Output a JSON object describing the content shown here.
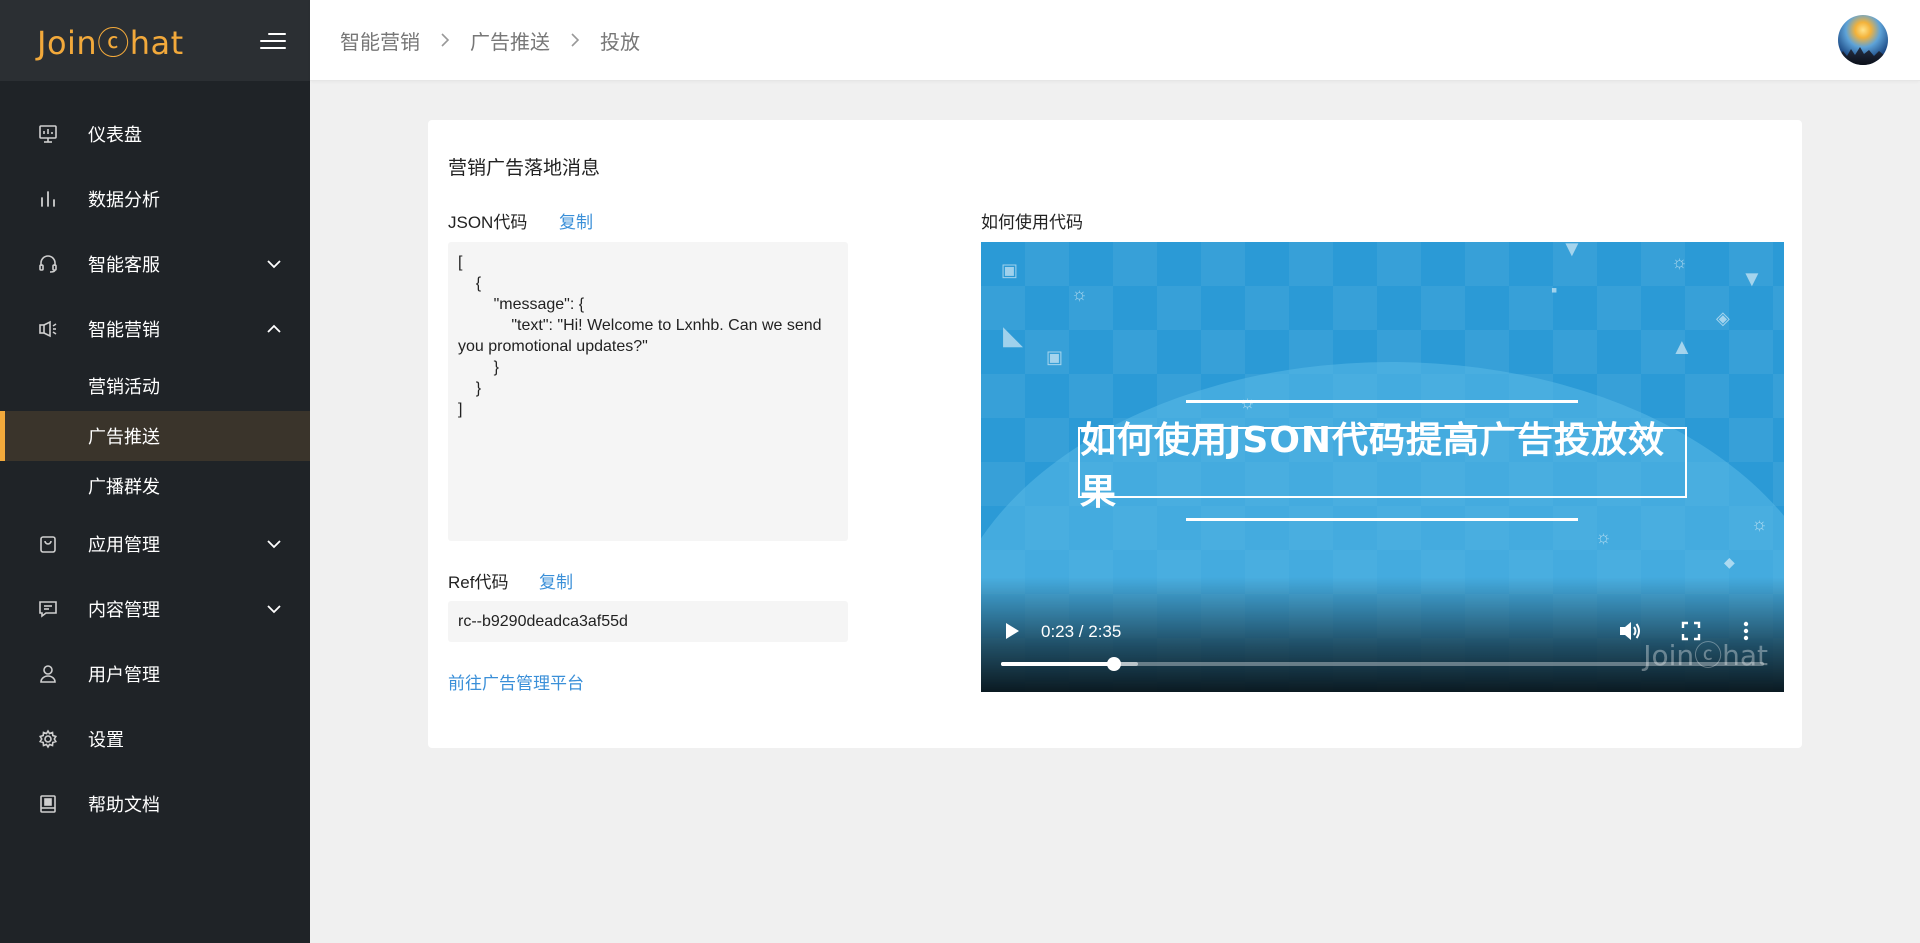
{
  "sidebar": {
    "logo": "Joinⓒhat",
    "items": [
      {
        "label": "仪表盘",
        "icon": "dashboard-icon"
      },
      {
        "label": "数据分析",
        "icon": "bar-chart-icon"
      },
      {
        "label": "智能客服",
        "icon": "headset-icon",
        "expand": "chevron-down-icon"
      },
      {
        "label": "智能营销",
        "icon": "megaphone-icon",
        "expand": "chevron-up-icon"
      },
      {
        "label": "应用管理",
        "icon": "shopping-bag-icon",
        "expand": "chevron-down-icon"
      },
      {
        "label": "内容管理",
        "icon": "message-icon",
        "expand": "chevron-down-icon"
      },
      {
        "label": "用户管理",
        "icon": "user-icon"
      },
      {
        "label": "设置",
        "icon": "gear-icon"
      },
      {
        "label": "帮助文档",
        "icon": "book-icon"
      }
    ],
    "sub_items": [
      {
        "label": "营销活动"
      },
      {
        "label": "广告推送",
        "active": true
      },
      {
        "label": "广播群发"
      }
    ]
  },
  "breadcrumb": [
    "智能营销",
    "广告推送",
    "投放"
  ],
  "card": {
    "title": "营销广告落地消息",
    "json_label": "JSON代码",
    "json_copy": "复制",
    "json_code": "[\n    {\n        \"message\": {\n            \"text\": \"Hi! Welcome to Lxnhb. Can we send you promotional updates?\"\n        }\n    }\n]",
    "ref_label": "Ref代码",
    "ref_copy": "复制",
    "ref_value": "rc--b9290deadca3af55d",
    "ads_link": "前往广告管理平台",
    "video_label": "如何使用代码"
  },
  "video": {
    "title_text": "如何使用JSON代码提高广告投放效果",
    "watermark": "Joinⓒhat",
    "time": "0:23 / 2:35",
    "progress_fraction": 0.148,
    "buffered_fraction": 0.18
  },
  "colors": {
    "accent": "#f2a93b",
    "link": "#3a8fd8",
    "sidebar_bg": "#1f2327",
    "video_bg": "#2b9ad6"
  }
}
